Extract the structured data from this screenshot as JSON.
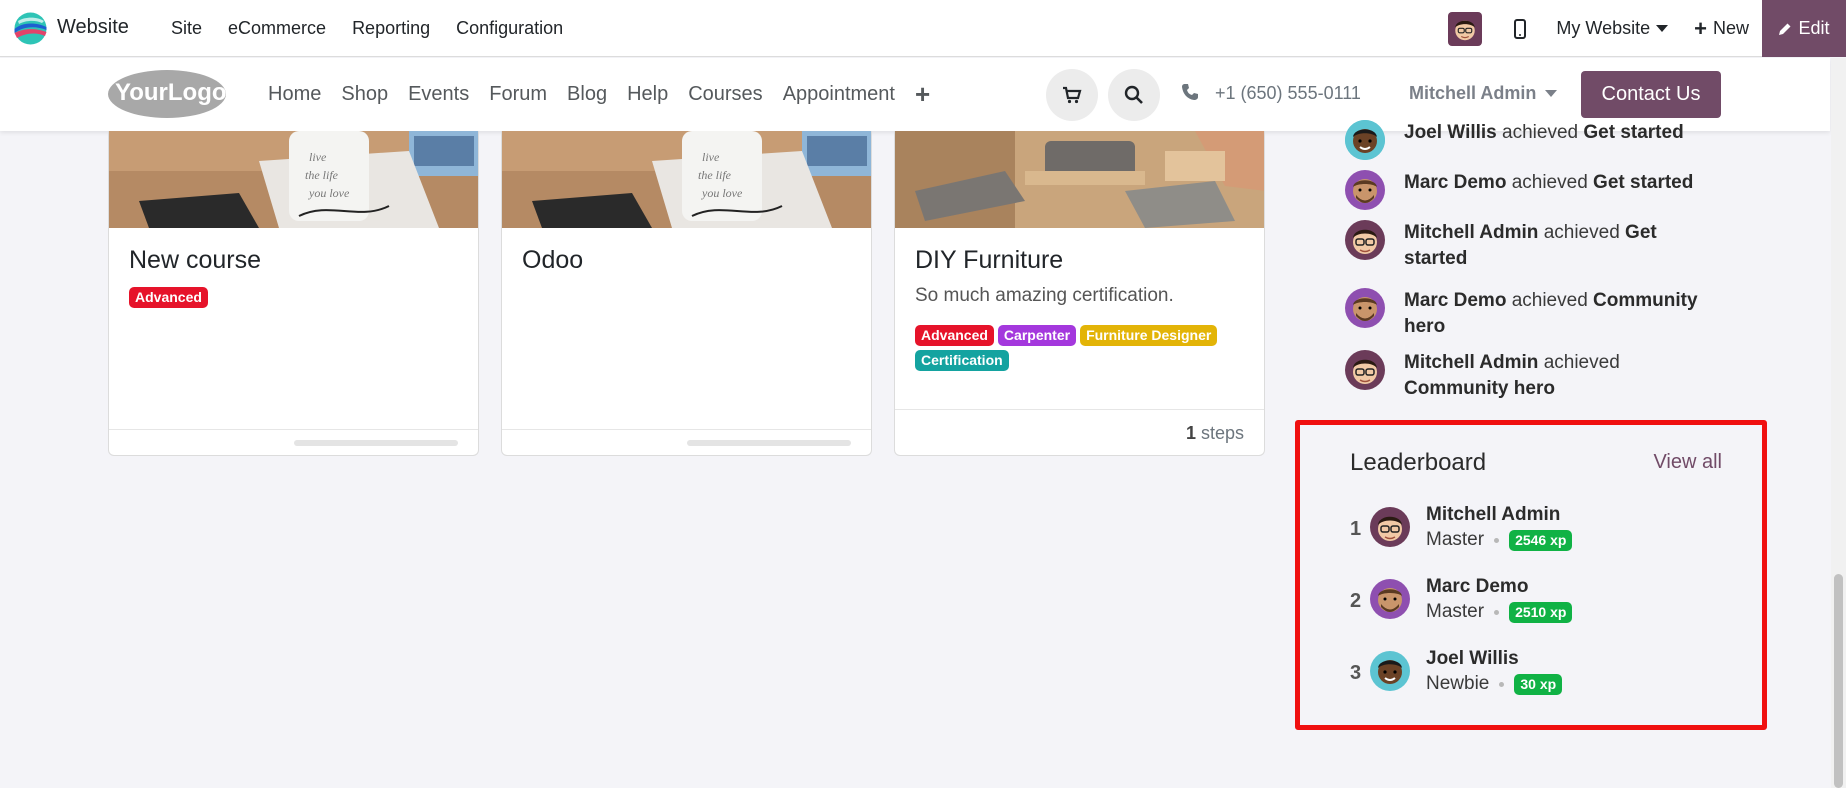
{
  "adminbar": {
    "app_name": "Website",
    "menu": [
      {
        "label": "Site"
      },
      {
        "label": "eCommerce"
      },
      {
        "label": "Reporting"
      },
      {
        "label": "Configuration"
      }
    ],
    "my_website": "My Website",
    "new_label": "New",
    "edit_label": "Edit",
    "accent_color": "#714b67"
  },
  "header": {
    "logo_text": "YourLogo",
    "nav": [
      {
        "label": "Home"
      },
      {
        "label": "Shop"
      },
      {
        "label": "Events"
      },
      {
        "label": "Forum"
      },
      {
        "label": "Blog"
      },
      {
        "label": "Help"
      },
      {
        "label": "Courses"
      },
      {
        "label": "Appointment"
      }
    ],
    "add_icon": "+",
    "phone": "+1 (650) 555-0111",
    "user": "Mitchell Admin",
    "contact_label": "Contact Us",
    "icons": [
      "cart-icon",
      "search-icon",
      "phone-icon"
    ]
  },
  "courses": [
    {
      "title": "New course",
      "description": "",
      "tags": [
        {
          "label": "Advanced",
          "color": "#e6132a"
        }
      ],
      "footer": "progress"
    },
    {
      "title": "Odoo",
      "description": "",
      "tags": [],
      "footer": "progress"
    },
    {
      "title": "DIY Furniture",
      "description": "So much amazing certification.",
      "tags": [
        {
          "label": "Advanced",
          "color": "#e6132a"
        },
        {
          "label": "Carpenter",
          "color": "#a438dd"
        },
        {
          "label": "Furniture Designer",
          "color": "#e3b407"
        },
        {
          "label": "Certification",
          "color": "#14a3a0"
        }
      ],
      "footer": "steps",
      "steps_count": "1",
      "steps_label": "steps"
    }
  ],
  "achievements": [
    {
      "user": "Joel Willis",
      "verb": "achieved",
      "badge": "Get started"
    },
    {
      "user": "Marc Demo",
      "verb": "achieved",
      "badge": "Get started"
    },
    {
      "user": "Mitchell Admin",
      "verb": "achieved",
      "badge": "Get started"
    },
    {
      "user": "Marc Demo",
      "verb": "achieved",
      "badge": "Community hero"
    },
    {
      "user": "Mitchell Admin",
      "verb": "achieved",
      "badge": "Community hero"
    }
  ],
  "leaderboard": {
    "title": "Leaderboard",
    "view_all": "View all",
    "rows": [
      {
        "rank": "1",
        "name": "Mitchell Admin",
        "rank_name": "Master",
        "xp": "2546 xp"
      },
      {
        "rank": "2",
        "name": "Marc Demo",
        "rank_name": "Master",
        "xp": "2510 xp"
      },
      {
        "rank": "3",
        "name": "Joel Willis",
        "rank_name": "Newbie",
        "xp": "30 xp"
      }
    ],
    "highlight_color": "#f01010",
    "xp_color": "#10b245"
  }
}
